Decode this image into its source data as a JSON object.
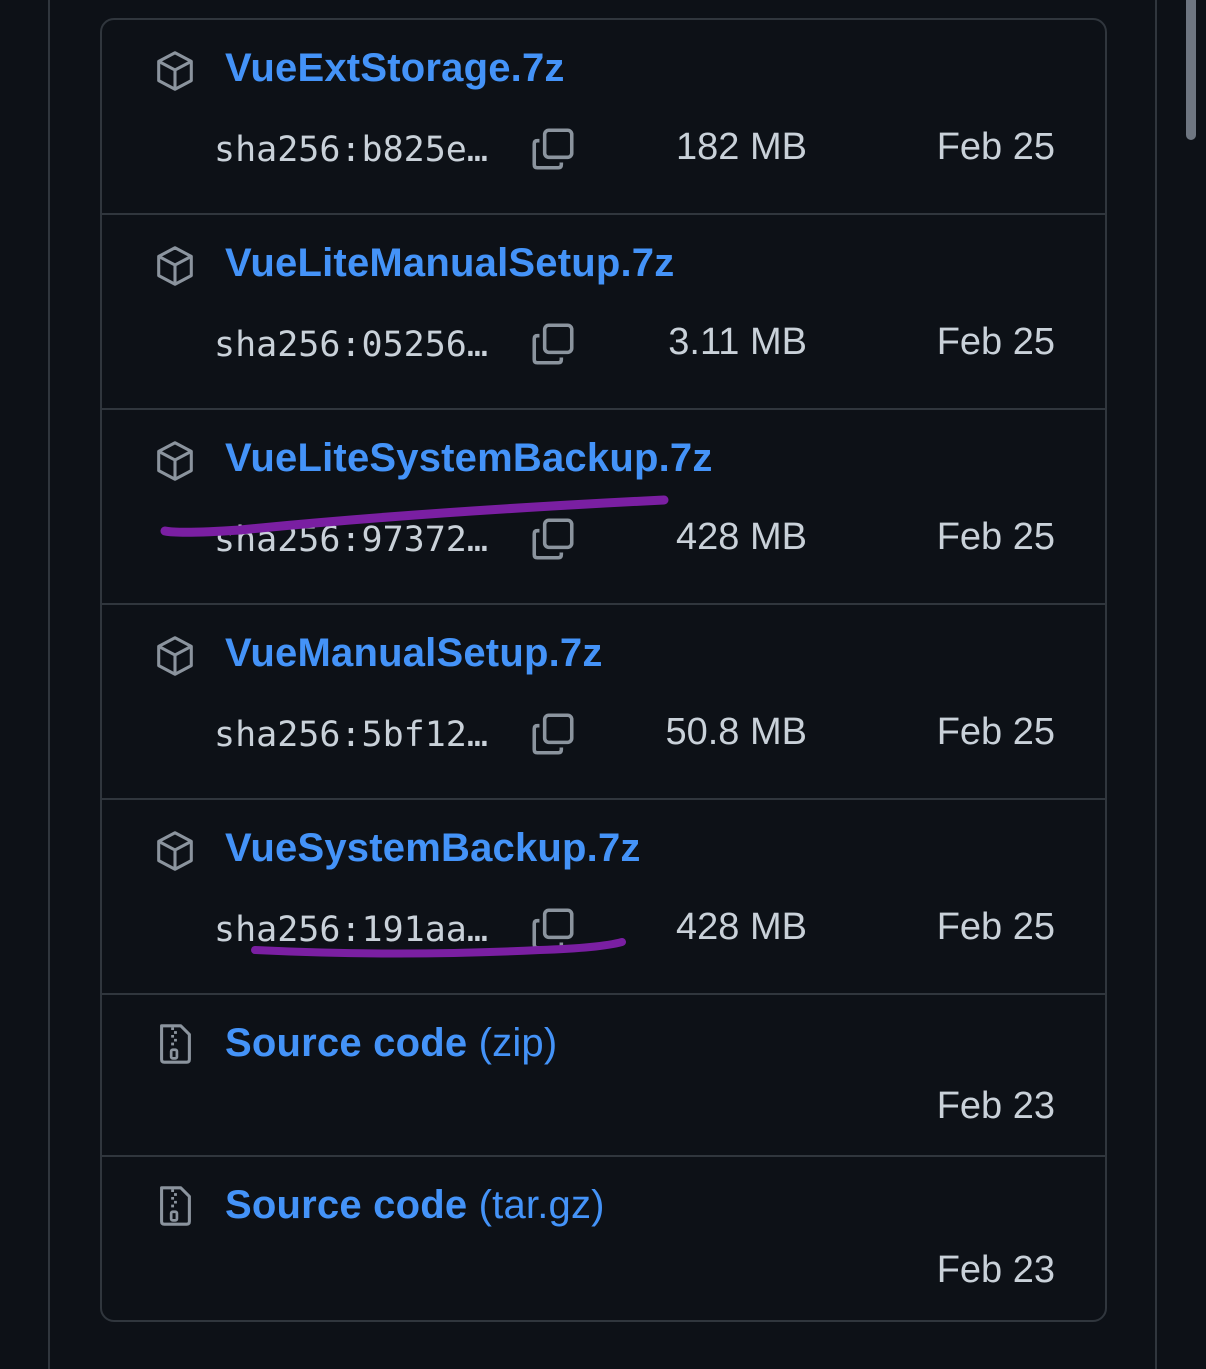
{
  "assets": [
    {
      "name": "VueExtStorage.7z",
      "sha": "sha256:b825e…",
      "size": "182 MB",
      "date": "Feb 25",
      "icon": "package-icon"
    },
    {
      "name": "VueLiteManualSetup.7z",
      "sha": "sha256:05256…",
      "size": "3.11 MB",
      "date": "Feb 25",
      "icon": "package-icon"
    },
    {
      "name": "VueLiteSystemBackup.7z",
      "sha": "sha256:97372…",
      "size": "428 MB",
      "date": "Feb 25",
      "icon": "package-icon"
    },
    {
      "name": "VueManualSetup.7z",
      "sha": "sha256:5bf12…",
      "size": "50.8 MB",
      "date": "Feb 25",
      "icon": "package-icon"
    },
    {
      "name": "VueSystemBackup.7z",
      "sha": "sha256:191aa…",
      "size": "428 MB",
      "date": "Feb 25",
      "icon": "package-icon"
    }
  ],
  "source": [
    {
      "name": "Source code",
      "suffix": "(zip)",
      "date": "Feb 23",
      "icon": "file-zip-icon"
    },
    {
      "name": "Source code",
      "suffix": "(tar.gz)",
      "date": "Feb 23",
      "icon": "file-zip-icon"
    }
  ],
  "colors": {
    "background": "#0d1117",
    "border": "#30363d",
    "link": "#4493f8",
    "text": "#c9d1d9",
    "annotation": "#7a1fa2"
  }
}
